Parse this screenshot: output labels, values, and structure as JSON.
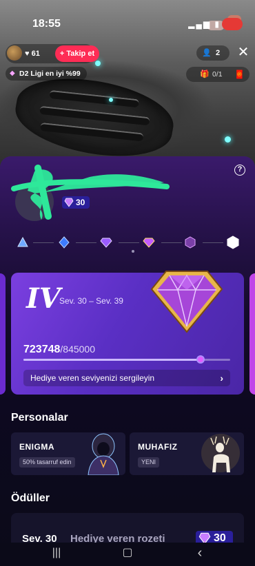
{
  "status_bar": {
    "time": "18:55"
  },
  "live_header": {
    "host_followers": "61",
    "follow_label": "+ Takip et",
    "viewer_count": "2",
    "league_text": "D2 Ligi en iyi %99",
    "goal_count": "0/1"
  },
  "sheet": {
    "level_badge": "30",
    "tiers": [
      "bronze-gem-icon",
      "blue-gem-icon",
      "purple-gem-icon",
      "violet-gem-icon",
      "pink-gem-icon",
      "white-gem-icon"
    ],
    "current_tier_index": 3,
    "card": {
      "roman": "IV",
      "range": "Sev. 30 – Sev. 39",
      "points": "723748",
      "points_total": "/845000",
      "progress": 0.856,
      "cta": "Hediye veren seviyenizi sergileyin"
    },
    "personas_title": "Personalar",
    "personas": [
      {
        "name": "ENIGMA",
        "tag": "50% tasarruf edin"
      },
      {
        "name": "MUHAFIZ",
        "tag": "YENI"
      }
    ],
    "rewards_title": "Ödüller",
    "reward": {
      "level": "Sev. 30",
      "name": "Hediye veren rozeti",
      "badge": "30"
    }
  },
  "colors": {
    "accent_pink": "#fe2c55",
    "card_purple": "#5a2fc4",
    "badge_blue": "#2a1f9a"
  }
}
